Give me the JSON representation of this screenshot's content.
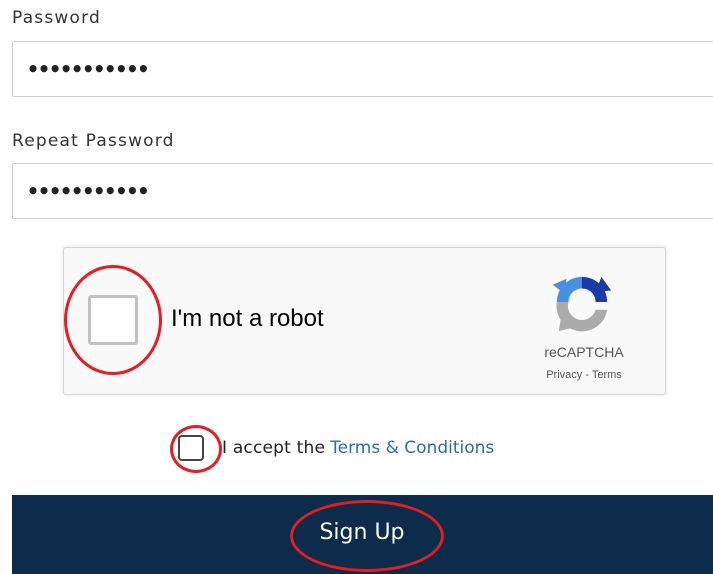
{
  "password": {
    "label": "Password",
    "value": "•••••••••••"
  },
  "repeat_password": {
    "label": "Repeat Password",
    "value": "•••••••••••"
  },
  "recaptcha": {
    "checkbox_label": "I'm not a robot",
    "brand": "reCAPTCHA",
    "privacy_link": "Privacy",
    "separator": " - ",
    "terms_link": "Terms",
    "checked": false,
    "logo_icon": "recaptcha-logo-icon"
  },
  "terms": {
    "prefix": "I accept the",
    "link": "Terms & Conditions",
    "checked": false
  },
  "signup": {
    "label": "Sign Up"
  },
  "colors": {
    "primary_button": "#0d2b4a",
    "link": "#2a6ab5",
    "highlight_ring": "#e41c23"
  }
}
